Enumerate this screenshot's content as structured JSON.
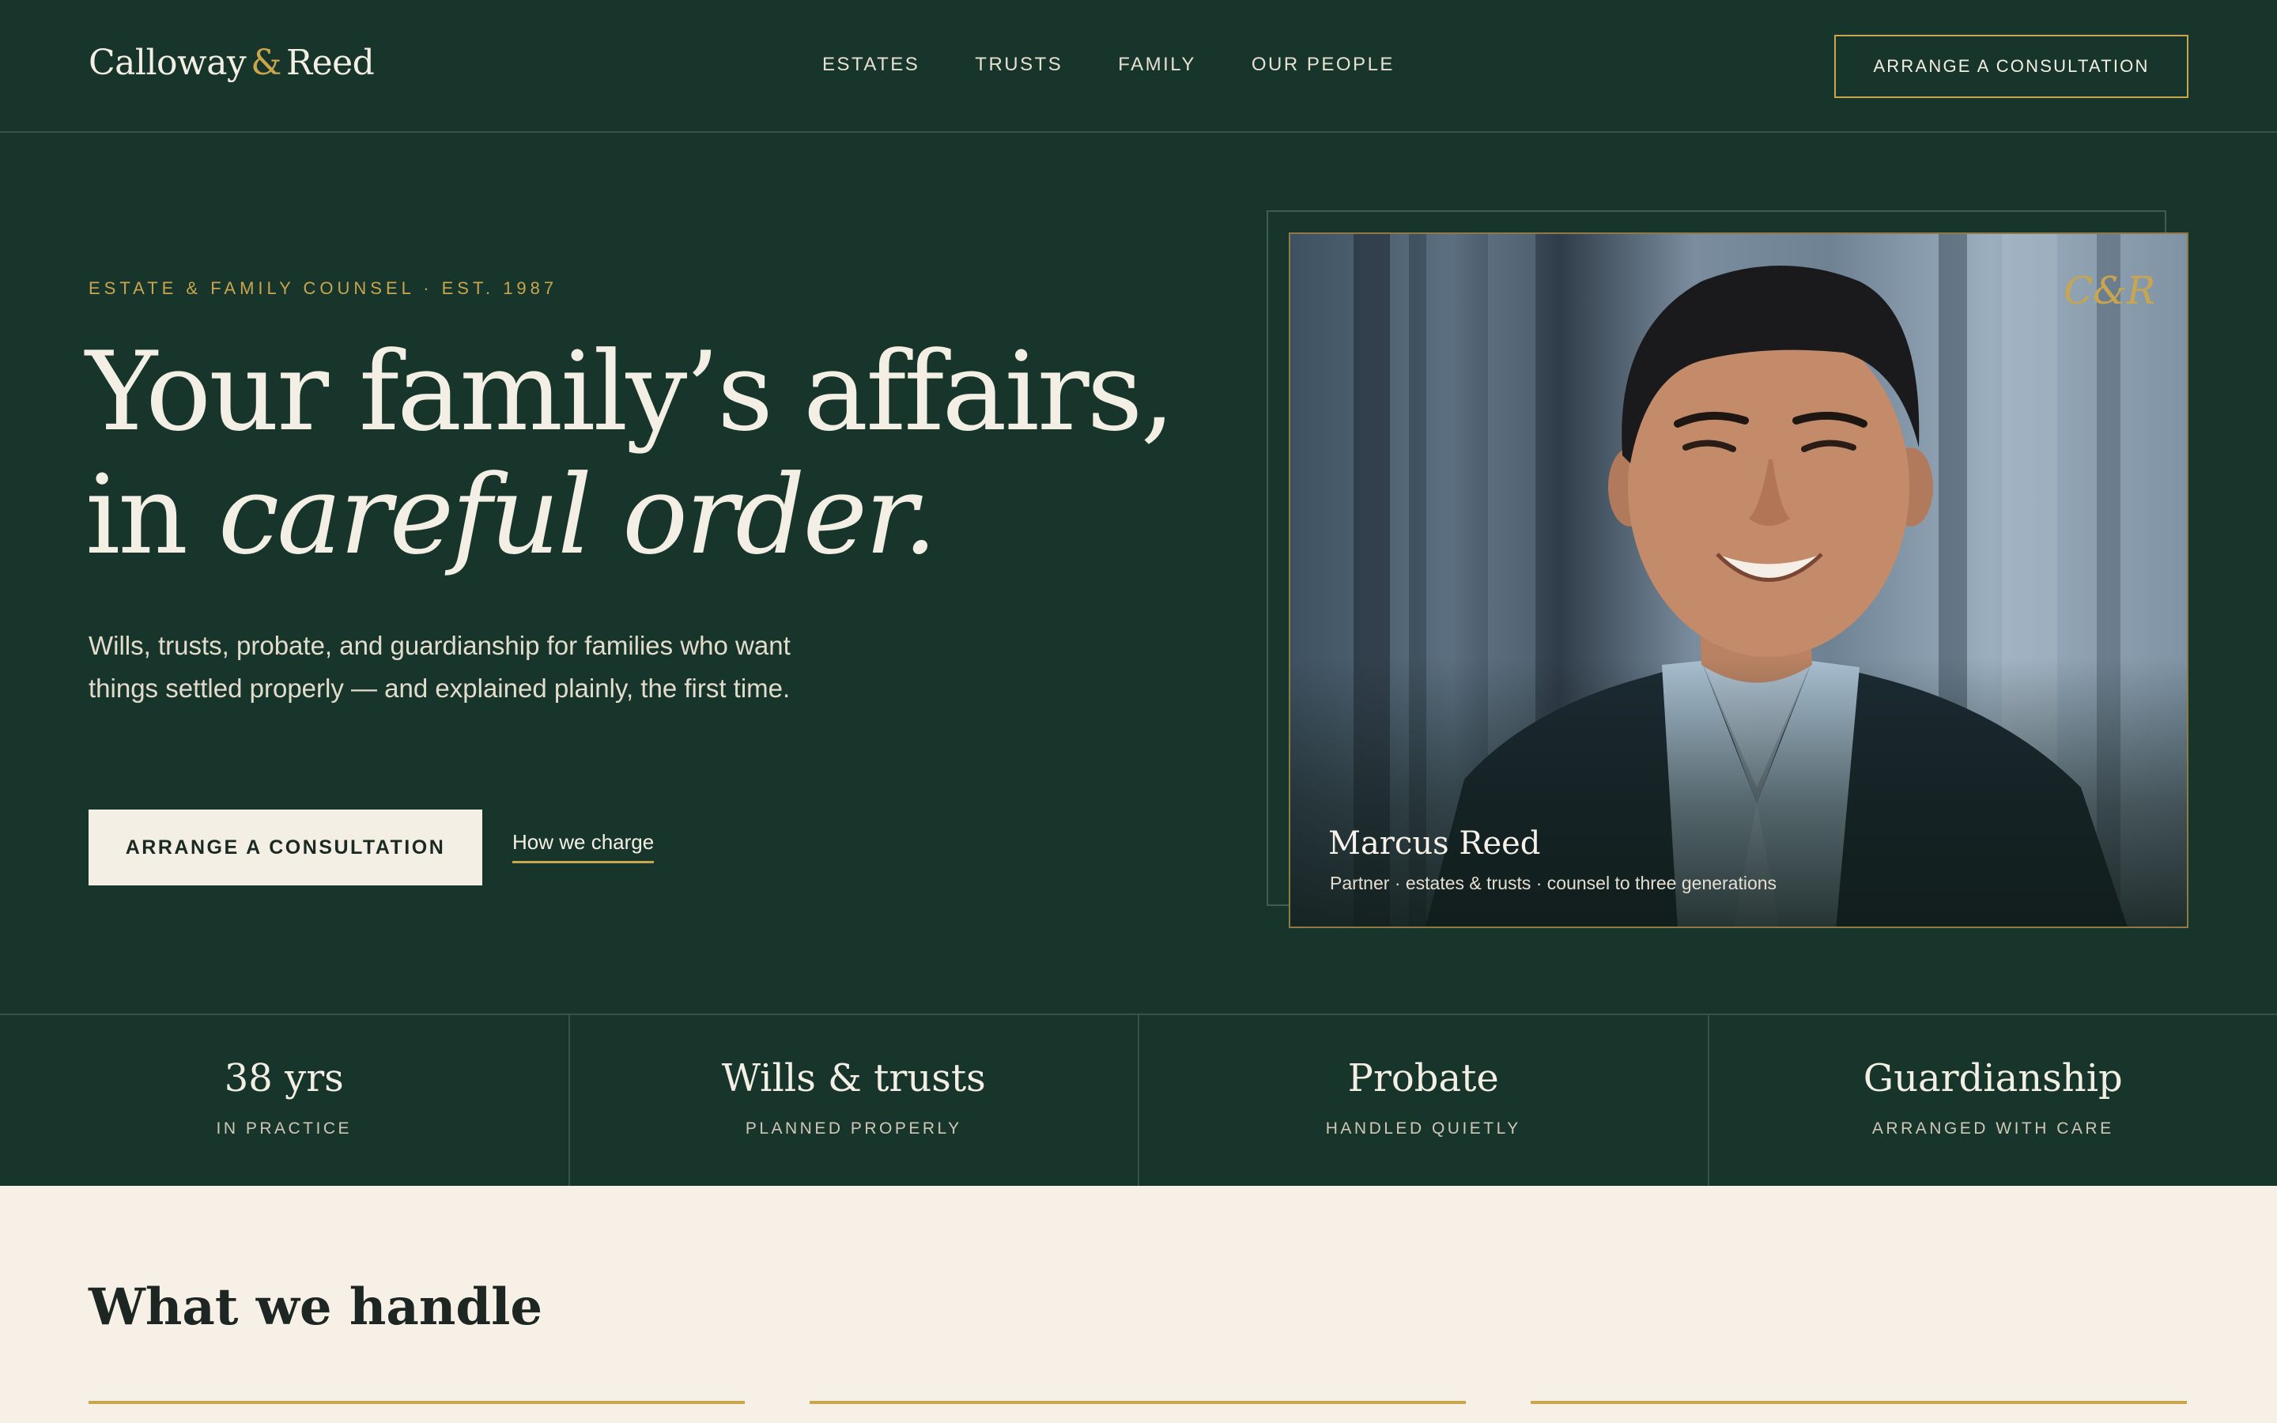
{
  "brand": {
    "name_part1": "Calloway",
    "ampersand": "&",
    "name_part2": "Reed"
  },
  "nav": {
    "items": [
      {
        "label": "ESTATES"
      },
      {
        "label": "TRUSTS"
      },
      {
        "label": "FAMILY"
      },
      {
        "label": "OUR PEOPLE"
      }
    ],
    "cta_label": "ARRANGE A CONSULTATION"
  },
  "hero": {
    "eyebrow": "ESTATE & FAMILY COUNSEL · EST. 1987",
    "headline_line1": "Your family’s affairs,",
    "headline_line2_prefix": "in ",
    "headline_line2_italic": "careful order.",
    "lede": "Wills, trusts, probate, and guardianship for families who want things settled properly — and explained plainly, the first time.",
    "primary_cta": "ARRANGE A CONSULTATION",
    "secondary_link": "How we charge"
  },
  "portrait": {
    "monogram": "C&R",
    "name": "Marcus Reed",
    "role": "Partner · estates & trusts · counsel to three generations"
  },
  "stats": [
    {
      "value": "38 yrs",
      "label": "IN PRACTICE"
    },
    {
      "value": "Wills & trusts",
      "label": "PLANNED PROPERLY"
    },
    {
      "value": "Probate",
      "label": "HANDLED QUIETLY"
    },
    {
      "value": "Guardianship",
      "label": "ARRANGED WITH CARE"
    }
  ],
  "services": {
    "title": "What we handle"
  },
  "colors": {
    "background": "#18352b",
    "accent_gold": "#c9a64e",
    "cream": "#f4efe4",
    "section_light": "#f6f0e6"
  }
}
